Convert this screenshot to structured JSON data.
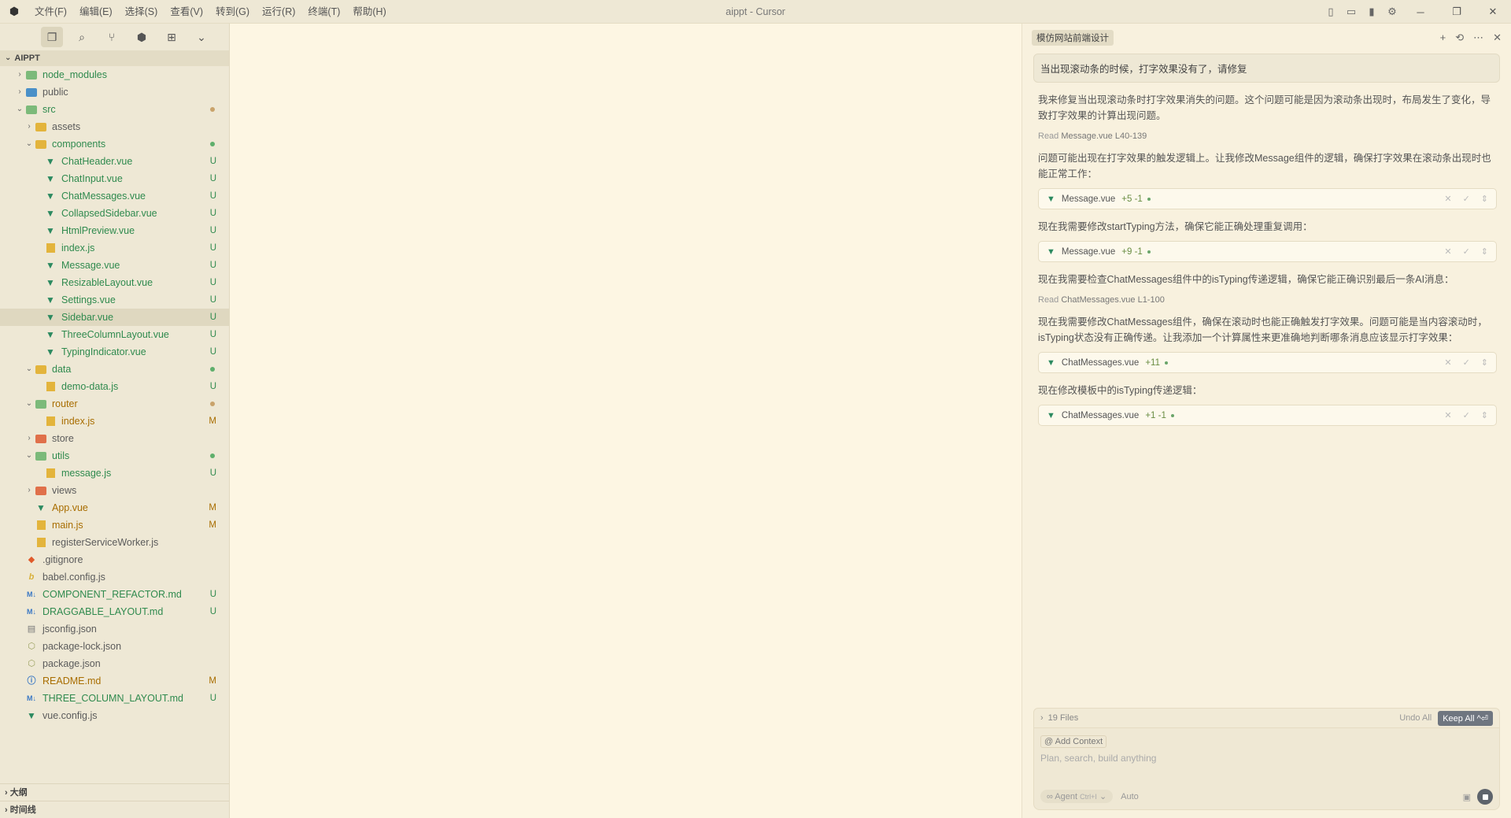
{
  "window": {
    "title": "aippt - Cursor"
  },
  "menu": [
    "文件(F)",
    "编辑(E)",
    "选择(S)",
    "查看(V)",
    "转到(G)",
    "运行(R)",
    "终端(T)",
    "帮助(H)"
  ],
  "explorer": {
    "root": "AIPPT",
    "items": [
      {
        "name": "node_modules",
        "depth": 0,
        "type": "folder",
        "chev": "closed",
        "color": "#2f8a4e",
        "fcolor": "#7cba7a",
        "status": ""
      },
      {
        "name": "public",
        "depth": 0,
        "type": "folder",
        "chev": "closed",
        "color": "#5b5b5b",
        "fcolor": "#4a90c8",
        "status": ""
      },
      {
        "name": "src",
        "depth": 0,
        "type": "folder",
        "chev": "open",
        "color": "#2f8a4e",
        "fcolor": "#7cba7a",
        "status": "dot-o"
      },
      {
        "name": "assets",
        "depth": 1,
        "type": "folder",
        "chev": "closed",
        "color": "#5b5b5b",
        "fcolor": "#e3b43c",
        "status": ""
      },
      {
        "name": "components",
        "depth": 1,
        "type": "folder",
        "chev": "open",
        "color": "#2f8a4e",
        "fcolor": "#e3b43c",
        "status": "dot-g"
      },
      {
        "name": "ChatHeader.vue",
        "depth": 2,
        "type": "vue",
        "color": "#2f8a4e",
        "status": "U"
      },
      {
        "name": "ChatInput.vue",
        "depth": 2,
        "type": "vue",
        "color": "#2f8a4e",
        "status": "U"
      },
      {
        "name": "ChatMessages.vue",
        "depth": 2,
        "type": "vue",
        "color": "#2f8a4e",
        "status": "U"
      },
      {
        "name": "CollapsedSidebar.vue",
        "depth": 2,
        "type": "vue",
        "color": "#2f8a4e",
        "status": "U"
      },
      {
        "name": "HtmlPreview.vue",
        "depth": 2,
        "type": "vue",
        "color": "#2f8a4e",
        "status": "U"
      },
      {
        "name": "index.js",
        "depth": 2,
        "type": "js",
        "color": "#2f8a4e",
        "status": "U"
      },
      {
        "name": "Message.vue",
        "depth": 2,
        "type": "vue",
        "color": "#2f8a4e",
        "status": "U"
      },
      {
        "name": "ResizableLayout.vue",
        "depth": 2,
        "type": "vue",
        "color": "#2f8a4e",
        "status": "U"
      },
      {
        "name": "Settings.vue",
        "depth": 2,
        "type": "vue",
        "color": "#2f8a4e",
        "status": "U"
      },
      {
        "name": "Sidebar.vue",
        "depth": 2,
        "type": "vue",
        "color": "#2f8a4e",
        "status": "U",
        "selected": true
      },
      {
        "name": "ThreeColumnLayout.vue",
        "depth": 2,
        "type": "vue",
        "color": "#2f8a4e",
        "status": "U"
      },
      {
        "name": "TypingIndicator.vue",
        "depth": 2,
        "type": "vue",
        "color": "#2f8a4e",
        "status": "U"
      },
      {
        "name": "data",
        "depth": 1,
        "type": "folder",
        "chev": "open",
        "color": "#2f8a4e",
        "fcolor": "#e3b43c",
        "status": "dot-g"
      },
      {
        "name": "demo-data.js",
        "depth": 2,
        "type": "js",
        "color": "#2f8a4e",
        "status": "U"
      },
      {
        "name": "router",
        "depth": 1,
        "type": "folder",
        "chev": "open",
        "color": "#a86d00",
        "fcolor": "#7cba7a",
        "status": "dot-o"
      },
      {
        "name": "index.js",
        "depth": 2,
        "type": "js",
        "color": "#a86d00",
        "status": "M"
      },
      {
        "name": "store",
        "depth": 1,
        "type": "folder",
        "chev": "closed",
        "color": "#5b5b5b",
        "fcolor": "#e0704a",
        "status": ""
      },
      {
        "name": "utils",
        "depth": 1,
        "type": "folder",
        "chev": "open",
        "color": "#2f8a4e",
        "fcolor": "#7cba7a",
        "status": "dot-g"
      },
      {
        "name": "message.js",
        "depth": 2,
        "type": "js",
        "color": "#2f8a4e",
        "status": "U"
      },
      {
        "name": "views",
        "depth": 1,
        "type": "folder",
        "chev": "closed",
        "color": "#5b5b5b",
        "fcolor": "#e0704a",
        "status": ""
      },
      {
        "name": "App.vue",
        "depth": 1,
        "type": "vue",
        "color": "#a86d00",
        "status": "M"
      },
      {
        "name": "main.js",
        "depth": 1,
        "type": "js",
        "color": "#a86d00",
        "status": "M"
      },
      {
        "name": "registerServiceWorker.js",
        "depth": 1,
        "type": "js",
        "color": "#5b5b5b",
        "status": ""
      },
      {
        "name": ".gitignore",
        "depth": 0,
        "type": "git",
        "color": "#5b5b5b",
        "status": ""
      },
      {
        "name": "babel.config.js",
        "depth": 0,
        "type": "babel",
        "color": "#5b5b5b",
        "status": ""
      },
      {
        "name": "COMPONENT_REFACTOR.md",
        "depth": 0,
        "type": "md",
        "color": "#2f8a4e",
        "status": "U"
      },
      {
        "name": "DRAGGABLE_LAYOUT.md",
        "depth": 0,
        "type": "md",
        "color": "#2f8a4e",
        "status": "U"
      },
      {
        "name": "jsconfig.json",
        "depth": 0,
        "type": "jsconfig",
        "color": "#5b5b5b",
        "status": ""
      },
      {
        "name": "package-lock.json",
        "depth": 0,
        "type": "json",
        "color": "#5b5b5b",
        "status": ""
      },
      {
        "name": "package.json",
        "depth": 0,
        "type": "json",
        "color": "#5b5b5b",
        "status": ""
      },
      {
        "name": "README.md",
        "depth": 0,
        "type": "info",
        "color": "#a86d00",
        "status": "M"
      },
      {
        "name": "THREE_COLUMN_LAYOUT.md",
        "depth": 0,
        "type": "md",
        "color": "#2f8a4e",
        "status": "U"
      },
      {
        "name": "vue.config.js",
        "depth": 0,
        "type": "vueconfig",
        "color": "#5b5b5b",
        "status": ""
      }
    ],
    "outline_label": "大纲",
    "timeline_label": "时间线"
  },
  "chat": {
    "tab_title": "模仿网站前端设计",
    "user_query": "当出现滚动条的时候，打字效果没有了，请修复",
    "blocks": [
      {
        "kind": "p",
        "text": "我来修复当出现滚动条时打字效果消失的问题。这个问题可能是因为滚动条出现时，布局发生了变化，导致打字效果的计算出现问题。"
      },
      {
        "kind": "read",
        "verb": "Read",
        "file": "Message.vue L40-139"
      },
      {
        "kind": "p",
        "text": "问题可能出现在打字效果的触发逻辑上。让我修改Message组件的逻辑，确保打字效果在滚动条出现时也能正常工作："
      },
      {
        "kind": "file",
        "file": "Message.vue",
        "diff": "+5 -1"
      },
      {
        "kind": "p",
        "text": "现在我需要修改startTyping方法，确保它能正确处理重复调用："
      },
      {
        "kind": "file",
        "file": "Message.vue",
        "diff": "+9 -1"
      },
      {
        "kind": "p",
        "text": "现在我需要检查ChatMessages组件中的isTyping传递逻辑，确保它能正确识别最后一条AI消息："
      },
      {
        "kind": "read",
        "verb": "Read",
        "file": "ChatMessages.vue L1-100"
      },
      {
        "kind": "p",
        "text": "现在我需要修改ChatMessages组件，确保在滚动时也能正确触发打字效果。问题可能是当内容滚动时，isTyping状态没有正确传递。让我添加一个计算属性来更准确地判断哪条消息应该显示打字效果："
      },
      {
        "kind": "file",
        "file": "ChatMessages.vue",
        "diff": "+11"
      },
      {
        "kind": "p",
        "text": "现在修改模板中的isTyping传递逻辑："
      },
      {
        "kind": "file",
        "file": "ChatMessages.vue",
        "diff": "+1 -1"
      }
    ],
    "files_count": "19 Files",
    "undo_all": "Undo All",
    "keep_all": "Keep All ^⏎",
    "add_context": "@ Add Context",
    "input_placeholder": "Plan, search, build anything",
    "mode": "∞ Agent",
    "mode_shortcut": "Ctrl+I",
    "model": "Auto"
  }
}
